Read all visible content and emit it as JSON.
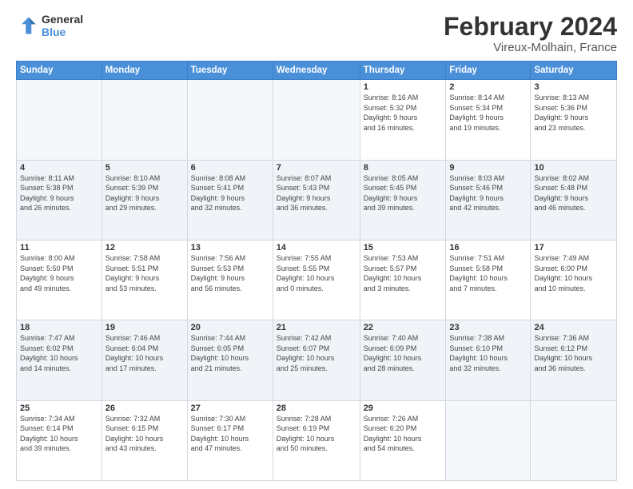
{
  "logo": {
    "text_general": "General",
    "text_blue": "Blue"
  },
  "header": {
    "title": "February 2024",
    "subtitle": "Vireux-Molhain, France"
  },
  "weekdays": [
    "Sunday",
    "Monday",
    "Tuesday",
    "Wednesday",
    "Thursday",
    "Friday",
    "Saturday"
  ],
  "weeks": [
    [
      {
        "day": "",
        "info": ""
      },
      {
        "day": "",
        "info": ""
      },
      {
        "day": "",
        "info": ""
      },
      {
        "day": "",
        "info": ""
      },
      {
        "day": "1",
        "info": "Sunrise: 8:16 AM\nSunset: 5:32 PM\nDaylight: 9 hours\nand 16 minutes."
      },
      {
        "day": "2",
        "info": "Sunrise: 8:14 AM\nSunset: 5:34 PM\nDaylight: 9 hours\nand 19 minutes."
      },
      {
        "day": "3",
        "info": "Sunrise: 8:13 AM\nSunset: 5:36 PM\nDaylight: 9 hours\nand 23 minutes."
      }
    ],
    [
      {
        "day": "4",
        "info": "Sunrise: 8:11 AM\nSunset: 5:38 PM\nDaylight: 9 hours\nand 26 minutes."
      },
      {
        "day": "5",
        "info": "Sunrise: 8:10 AM\nSunset: 5:39 PM\nDaylight: 9 hours\nand 29 minutes."
      },
      {
        "day": "6",
        "info": "Sunrise: 8:08 AM\nSunset: 5:41 PM\nDaylight: 9 hours\nand 32 minutes."
      },
      {
        "day": "7",
        "info": "Sunrise: 8:07 AM\nSunset: 5:43 PM\nDaylight: 9 hours\nand 36 minutes."
      },
      {
        "day": "8",
        "info": "Sunrise: 8:05 AM\nSunset: 5:45 PM\nDaylight: 9 hours\nand 39 minutes."
      },
      {
        "day": "9",
        "info": "Sunrise: 8:03 AM\nSunset: 5:46 PM\nDaylight: 9 hours\nand 42 minutes."
      },
      {
        "day": "10",
        "info": "Sunrise: 8:02 AM\nSunset: 5:48 PM\nDaylight: 9 hours\nand 46 minutes."
      }
    ],
    [
      {
        "day": "11",
        "info": "Sunrise: 8:00 AM\nSunset: 5:50 PM\nDaylight: 9 hours\nand 49 minutes."
      },
      {
        "day": "12",
        "info": "Sunrise: 7:58 AM\nSunset: 5:51 PM\nDaylight: 9 hours\nand 53 minutes."
      },
      {
        "day": "13",
        "info": "Sunrise: 7:56 AM\nSunset: 5:53 PM\nDaylight: 9 hours\nand 56 minutes."
      },
      {
        "day": "14",
        "info": "Sunrise: 7:55 AM\nSunset: 5:55 PM\nDaylight: 10 hours\nand 0 minutes."
      },
      {
        "day": "15",
        "info": "Sunrise: 7:53 AM\nSunset: 5:57 PM\nDaylight: 10 hours\nand 3 minutes."
      },
      {
        "day": "16",
        "info": "Sunrise: 7:51 AM\nSunset: 5:58 PM\nDaylight: 10 hours\nand 7 minutes."
      },
      {
        "day": "17",
        "info": "Sunrise: 7:49 AM\nSunset: 6:00 PM\nDaylight: 10 hours\nand 10 minutes."
      }
    ],
    [
      {
        "day": "18",
        "info": "Sunrise: 7:47 AM\nSunset: 6:02 PM\nDaylight: 10 hours\nand 14 minutes."
      },
      {
        "day": "19",
        "info": "Sunrise: 7:46 AM\nSunset: 6:04 PM\nDaylight: 10 hours\nand 17 minutes."
      },
      {
        "day": "20",
        "info": "Sunrise: 7:44 AM\nSunset: 6:05 PM\nDaylight: 10 hours\nand 21 minutes."
      },
      {
        "day": "21",
        "info": "Sunrise: 7:42 AM\nSunset: 6:07 PM\nDaylight: 10 hours\nand 25 minutes."
      },
      {
        "day": "22",
        "info": "Sunrise: 7:40 AM\nSunset: 6:09 PM\nDaylight: 10 hours\nand 28 minutes."
      },
      {
        "day": "23",
        "info": "Sunrise: 7:38 AM\nSunset: 6:10 PM\nDaylight: 10 hours\nand 32 minutes."
      },
      {
        "day": "24",
        "info": "Sunrise: 7:36 AM\nSunset: 6:12 PM\nDaylight: 10 hours\nand 36 minutes."
      }
    ],
    [
      {
        "day": "25",
        "info": "Sunrise: 7:34 AM\nSunset: 6:14 PM\nDaylight: 10 hours\nand 39 minutes."
      },
      {
        "day": "26",
        "info": "Sunrise: 7:32 AM\nSunset: 6:15 PM\nDaylight: 10 hours\nand 43 minutes."
      },
      {
        "day": "27",
        "info": "Sunrise: 7:30 AM\nSunset: 6:17 PM\nDaylight: 10 hours\nand 47 minutes."
      },
      {
        "day": "28",
        "info": "Sunrise: 7:28 AM\nSunset: 6:19 PM\nDaylight: 10 hours\nand 50 minutes."
      },
      {
        "day": "29",
        "info": "Sunrise: 7:26 AM\nSunset: 6:20 PM\nDaylight: 10 hours\nand 54 minutes."
      },
      {
        "day": "",
        "info": ""
      },
      {
        "day": "",
        "info": ""
      }
    ]
  ]
}
